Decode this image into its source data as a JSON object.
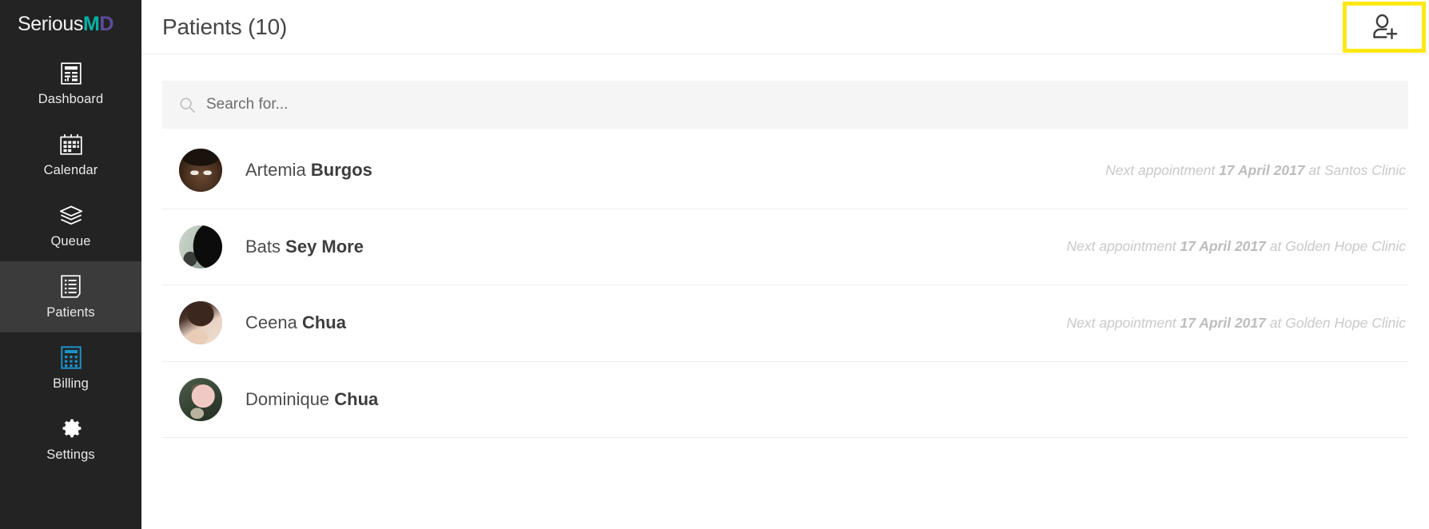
{
  "brand": {
    "name_part1": "Serious",
    "name_part2_m": "M",
    "name_part3_d": "D",
    "teal": "#00b3a4",
    "purple": "#5d4b9c"
  },
  "sidebar": {
    "items": [
      {
        "label": "Dashboard",
        "icon": "dashboard-icon",
        "active": false
      },
      {
        "label": "Calendar",
        "icon": "calendar-icon",
        "active": false
      },
      {
        "label": "Queue",
        "icon": "layers-icon",
        "active": false
      },
      {
        "label": "Patients",
        "icon": "list-icon",
        "active": true
      },
      {
        "label": "Billing",
        "icon": "calculator-icon",
        "active": false
      },
      {
        "label": "Settings",
        "icon": "gear-icon",
        "active": false
      }
    ],
    "billing_icon_color": "#1b93c8",
    "active_bg": "#3b3b3b"
  },
  "header": {
    "title": "Patients (10)",
    "add_patient_icon": "add-person-icon",
    "highlight_color": "#ffe816"
  },
  "search": {
    "placeholder": "Search for...",
    "value": "",
    "icon": "search-icon"
  },
  "patients": [
    {
      "first_name": "Artemia",
      "last_name": "Burgos",
      "appointment_prefix": "Next appointment",
      "appointment_date": "17 April 2017",
      "appointment_suffix": "at Santos Clinic"
    },
    {
      "first_name": "Bats",
      "last_name": "Sey More",
      "appointment_prefix": "Next appointment",
      "appointment_date": "17 April 2017",
      "appointment_suffix": "at Golden Hope Clinic"
    },
    {
      "first_name": "Ceena",
      "last_name": "Chua",
      "appointment_prefix": "Next appointment",
      "appointment_date": "17 April 2017",
      "appointment_suffix": "at Golden Hope Clinic"
    },
    {
      "first_name": "Dominique",
      "last_name": "Chua",
      "appointment_prefix": "",
      "appointment_date": "",
      "appointment_suffix": ""
    }
  ]
}
